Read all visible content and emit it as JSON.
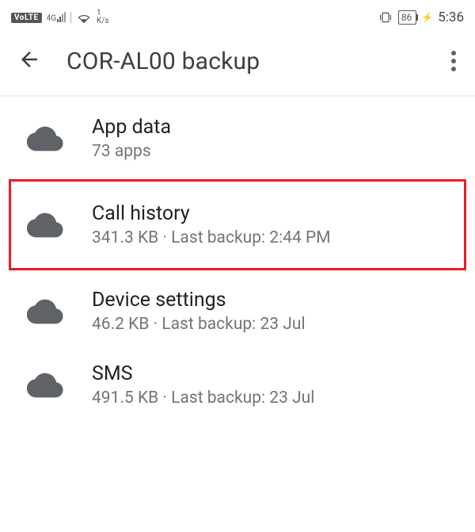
{
  "status": {
    "volte": "VoLTE",
    "net_label": "4G",
    "speed_value": "1",
    "speed_unit": "K/s",
    "battery": "86",
    "charge_glyph": "⚡",
    "clock": "5:36",
    "vibrate_glyph": "📳"
  },
  "header": {
    "title": "COR-AL00 backup"
  },
  "rows": [
    {
      "title": "App data",
      "sub": "73 apps"
    },
    {
      "title": "Call history",
      "sub": "341.3 KB · Last backup: 2:44 PM"
    },
    {
      "title": "Device settings",
      "sub": "46.2 KB · Last backup: 23 Jul"
    },
    {
      "title": "SMS",
      "sub": "491.5 KB · Last backup: 23 Jul"
    }
  ]
}
